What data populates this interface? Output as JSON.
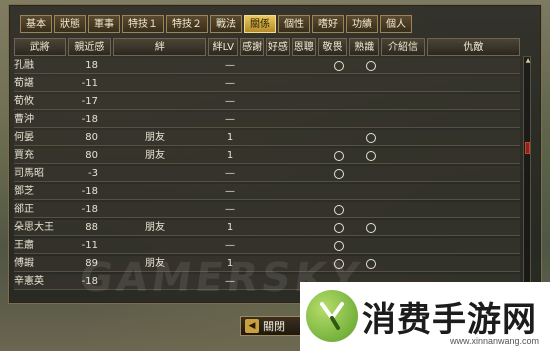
{
  "tabs": [
    "基本",
    "狀態",
    "軍事",
    "特技１",
    "特技２",
    "戰法",
    "關係",
    "個性",
    "嗜好",
    "功績",
    "個人"
  ],
  "active_tab": "關係",
  "columns": [
    "武將",
    "親近感",
    "絆",
    "絆LV",
    "感謝",
    "好感",
    "恩聰",
    "敬畏",
    "熟識",
    "介紹信",
    "仇敵"
  ],
  "rows": [
    {
      "name": "孔融",
      "affinity": "18",
      "bond": "",
      "lv": "—",
      "respect": true,
      "familiar": true
    },
    {
      "name": "荀諶",
      "affinity": "-11",
      "bond": "",
      "lv": "—",
      "respect": false,
      "familiar": false
    },
    {
      "name": "荀攸",
      "affinity": "-17",
      "bond": "",
      "lv": "—",
      "respect": false,
      "familiar": false
    },
    {
      "name": "曹沖",
      "affinity": "-18",
      "bond": "",
      "lv": "—",
      "respect": false,
      "familiar": false
    },
    {
      "name": "何晏",
      "affinity": "80",
      "bond": "朋友",
      "lv": "1",
      "respect": false,
      "familiar": true
    },
    {
      "name": "賈充",
      "affinity": "80",
      "bond": "朋友",
      "lv": "1",
      "respect": true,
      "familiar": true
    },
    {
      "name": "司馬昭",
      "affinity": "-3",
      "bond": "",
      "lv": "—",
      "respect": true,
      "familiar": false
    },
    {
      "name": "鄧芝",
      "affinity": "-18",
      "bond": "",
      "lv": "—",
      "respect": false,
      "familiar": false
    },
    {
      "name": "郤正",
      "affinity": "-18",
      "bond": "",
      "lv": "—",
      "respect": true,
      "familiar": false
    },
    {
      "name": "朵思大王",
      "affinity": "88",
      "bond": "朋友",
      "lv": "1",
      "respect": true,
      "familiar": true
    },
    {
      "name": "王肅",
      "affinity": "-11",
      "bond": "",
      "lv": "—",
      "respect": true,
      "familiar": false
    },
    {
      "name": "傅嘏",
      "affinity": "89",
      "bond": "朋友",
      "lv": "1",
      "respect": true,
      "familiar": true
    },
    {
      "name": "辛憲英",
      "affinity": "-18",
      "bond": "",
      "lv": "—",
      "respect": false,
      "familiar": false
    }
  ],
  "watermark": "GAMERSKY",
  "close_label": "關閉",
  "promo": {
    "title": "消费手游网",
    "url": "www.xinnanwang.com"
  }
}
